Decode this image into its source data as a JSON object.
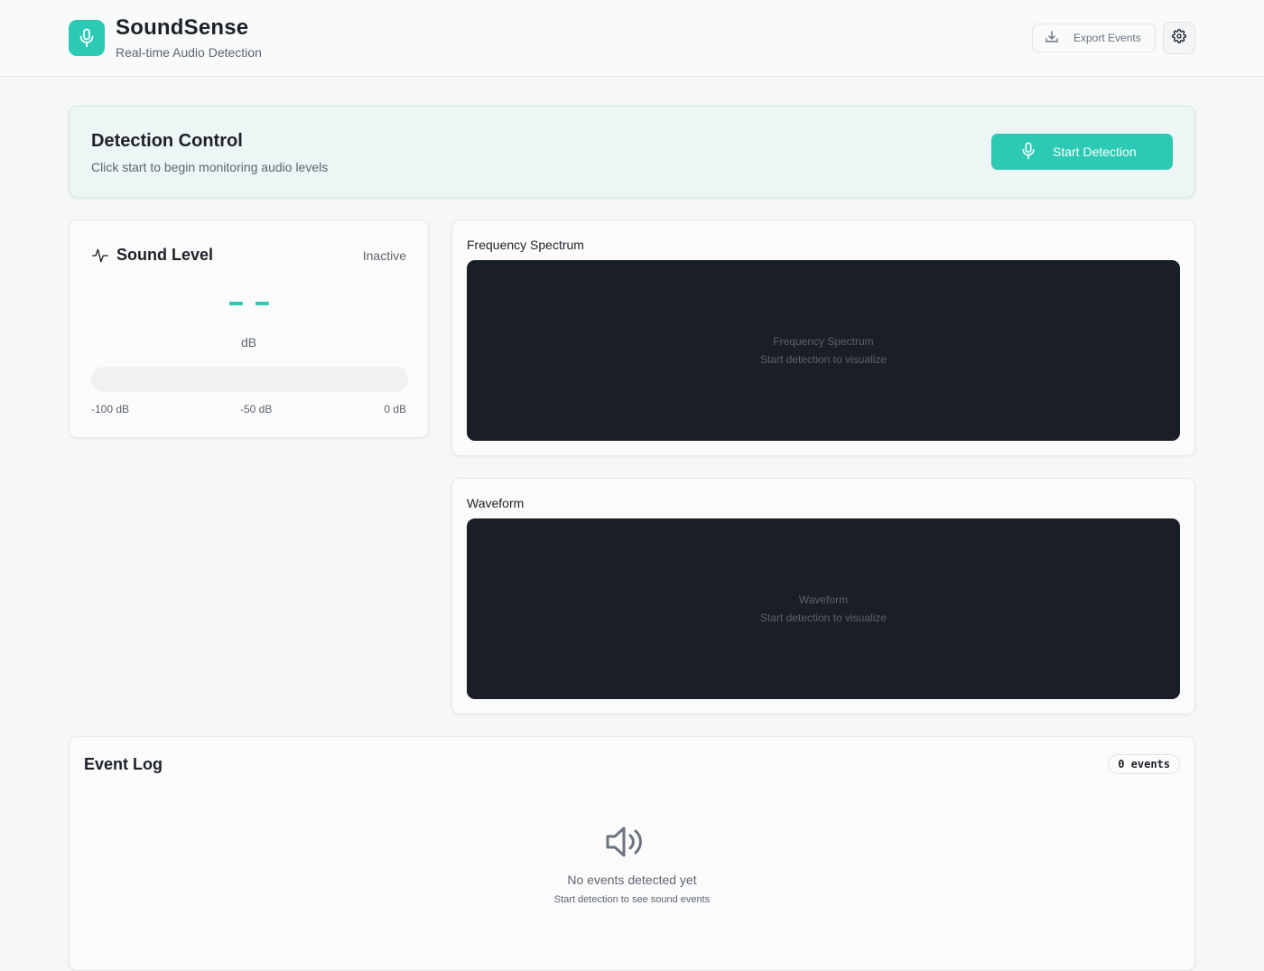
{
  "header": {
    "title": "SoundSense",
    "subtitle": "Real-time Audio Detection",
    "export_label": "Export Events",
    "icons": {
      "logo": "microphone-icon",
      "export": "download-icon",
      "settings": "gear-icon"
    }
  },
  "control": {
    "title": "Detection Control",
    "subtitle": "Click start to begin monitoring audio levels",
    "start_label": "Start Detection"
  },
  "sound_level": {
    "title": "Sound Level",
    "status": "Inactive",
    "unit": "dB",
    "level_fraction": 0,
    "scale": [
      "-100 dB",
      "-50 dB",
      "0 dB"
    ]
  },
  "spectrum": {
    "title": "Frequency Spectrum",
    "placeholder_title": "Frequency Spectrum",
    "placeholder_sub": "Start detection to visualize"
  },
  "waveform": {
    "title": "Waveform",
    "placeholder_title": "Waveform",
    "placeholder_sub": "Start detection to visualize"
  },
  "events": {
    "title": "Event Log",
    "badge": "0 events",
    "empty_title": "No events detected yet",
    "empty_sub": "Start detection to see sound events"
  },
  "colors": {
    "accent": "#2cc9b5",
    "canvas": "#1a1f26"
  }
}
